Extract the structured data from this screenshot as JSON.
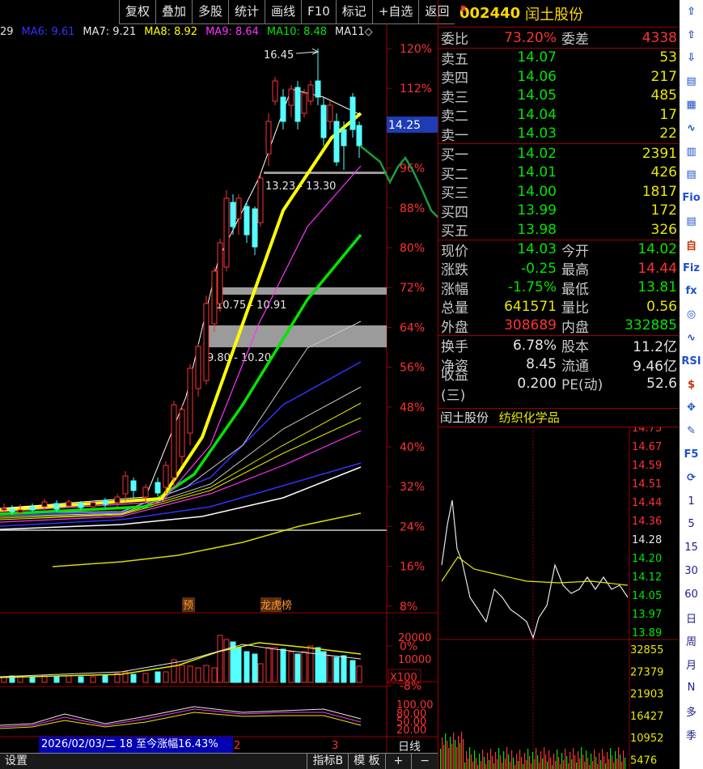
{
  "toolbar": {
    "buttons": [
      "复权",
      "叠加",
      "多股",
      "统计",
      "画线",
      "F10",
      "标记",
      "+自选",
      "返回"
    ]
  },
  "ma_row": [
    {
      "text": "29",
      "color": "#e6e6e6"
    },
    {
      "text": "MA6: 9.61",
      "color": "#3232ff"
    },
    {
      "text": "MA7: 9.21",
      "color": "#e6e6e6"
    },
    {
      "text": "MA8: 8.92",
      "color": "#ffff00"
    },
    {
      "text": "MA9: 8.64",
      "color": "#ff32ff"
    },
    {
      "text": "MA10: 8.48",
      "color": "#00e600"
    },
    {
      "text": "MA11◇",
      "color": "#e6e6e6"
    }
  ],
  "chart": {
    "pct_labels": [
      "120%",
      "112%",
      "104%",
      "96%",
      "88%",
      "80%",
      "72%",
      "64%",
      "56%",
      "48%",
      "40%",
      "32%",
      "24%",
      "16%",
      "8%",
      "0%",
      "-8%"
    ],
    "current_price": "14.25",
    "high_label": "16.45",
    "zone1": "13.23 - 13.30",
    "zone2": "10.75 - 10.91",
    "zone3": "9.80 - 10.20",
    "tag_pre": "预",
    "tag_rank": "龙虎榜",
    "vol_labels": [
      "20000",
      "10000"
    ],
    "vol_unit": "X100",
    "ind_labels": [
      "100.00",
      "80.00",
      "50.00",
      "20.00"
    ],
    "marker2": "2",
    "marker3": "3",
    "range_text": "2026/02/03/二 18 至今涨幅16.43%",
    "bottom_left": "设置",
    "bottom_tabs": [
      "指标B",
      "模 板",
      "+",
      "−"
    ],
    "period_label": "日线"
  },
  "quote": {
    "flag": "R",
    "code": "002440",
    "name": "闰土股份",
    "weibi_label": "委比",
    "weibi": "73.20%",
    "weicha_label": "委差",
    "weicha": "4338",
    "asks": [
      {
        "label": "卖五",
        "price": "14.07",
        "vol": "53"
      },
      {
        "label": "卖四",
        "price": "14.06",
        "vol": "217"
      },
      {
        "label": "卖三",
        "price": "14.05",
        "vol": "485"
      },
      {
        "label": "卖二",
        "price": "14.04",
        "vol": "17"
      },
      {
        "label": "卖一",
        "price": "14.03",
        "vol": "22"
      }
    ],
    "bids": [
      {
        "label": "买一",
        "price": "14.02",
        "vol": "2391"
      },
      {
        "label": "买二",
        "price": "14.01",
        "vol": "426"
      },
      {
        "label": "买三",
        "price": "14.00",
        "vol": "1817"
      },
      {
        "label": "买四",
        "price": "13.99",
        "vol": "172"
      },
      {
        "label": "买五",
        "price": "13.98",
        "vol": "326"
      }
    ],
    "stats": [
      {
        "l1": "现价",
        "v1": "14.03",
        "c1": "green",
        "l2": "今开",
        "v2": "14.02",
        "c2": "green"
      },
      {
        "l1": "涨跌",
        "v1": "-0.25",
        "c1": "green",
        "l2": "最高",
        "v2": "14.44",
        "c2": "red"
      },
      {
        "l1": "涨幅",
        "v1": "-1.75%",
        "c1": "green",
        "l2": "最低",
        "v2": "13.81",
        "c2": "green"
      },
      {
        "l1": "总量",
        "v1": "641571",
        "c1": "yellow",
        "l2": "量比",
        "v2": "0.56",
        "c2": "yellow"
      },
      {
        "l1": "外盘",
        "v1": "308689",
        "c1": "red",
        "l2": "内盘",
        "v2": "332885",
        "c2": "green"
      }
    ],
    "stats2": [
      {
        "l1": "换手",
        "v1": "6.78%",
        "c1": "white",
        "l2": "股本",
        "v2": "11.2亿",
        "c2": "white"
      },
      {
        "l1": "净资",
        "v1": "8.45",
        "c1": "white",
        "l2": "流通",
        "v2": "9.46亿",
        "c2": "white"
      },
      {
        "l1": "收益(三)",
        "v1": "0.200",
        "c1": "white",
        "l2": "PE(动)",
        "v2": "52.6",
        "c2": "white"
      }
    ],
    "industry_name": "闰土股份",
    "industry": "纺织化学品",
    "minute_prices": [
      "14.75",
      "14.67",
      "14.59",
      "14.51",
      "14.44",
      "14.36",
      "14.28",
      "14.20",
      "14.12",
      "14.05",
      "13.97",
      "13.89"
    ],
    "minute_vols": [
      "32855",
      "27379",
      "21903",
      "16427",
      "10952",
      "5476"
    ]
  },
  "iconcol": {
    "items": [
      "⇧",
      "⇧",
      "⇩",
      "▤",
      "▦",
      "∿",
      "▥",
      "▤",
      "Fio",
      "▤",
      "自",
      "Fiz",
      "fx",
      "◎",
      "∿",
      "RSI",
      "$",
      "✥",
      "✎",
      "F5",
      "⟳",
      "1",
      "5",
      "15",
      "30",
      "60",
      "日",
      "周",
      "月",
      "N",
      "多",
      "季"
    ]
  }
}
